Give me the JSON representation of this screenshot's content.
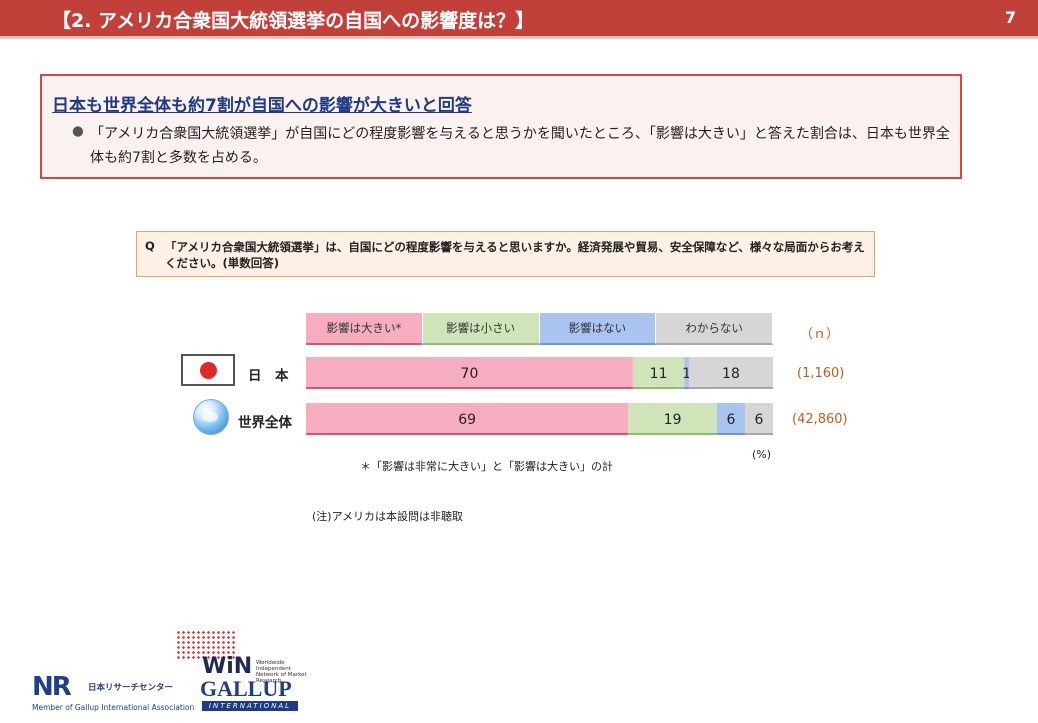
{
  "header": {
    "title": "【2. アメリカ合衆国大統領選挙の自国への影響度は？】",
    "page_number": "7"
  },
  "summary": {
    "title": "日本も世界全体も約7割が自国への影響が大きいと回答",
    "bullet": "●",
    "text": "「アメリカ合衆国大統領選挙」が自国にどの程度影響を与えると思うかを聞いたところ、「影響は大きい」と答えた割合は、日本も世界全体も約7割と多数を占める。"
  },
  "question": {
    "label": "Q",
    "text": "「アメリカ合衆国大統領選挙」は、自国にどの程度影響を与えると思いますか。経済発展や貿易、安全保障など、様々な局面からお考えください。(単数回答)"
  },
  "chart_data": {
    "type": "bar",
    "orientation": "horizontal-stacked-100",
    "unit": "(%)",
    "n_header": "（ｎ）",
    "categories": [
      "日　本",
      "世界全体"
    ],
    "n_values": [
      "(1,160)",
      "(42,860)"
    ],
    "series": [
      {
        "name": "影響は大きい*",
        "values": [
          70,
          69
        ],
        "color": "#f7adc0"
      },
      {
        "name": "影響は小さい",
        "values": [
          11,
          19
        ],
        "color": "#cfe5b9"
      },
      {
        "name": "影響はない",
        "values": [
          1,
          6
        ],
        "color": "#a9c4ef"
      },
      {
        "name": "わからない",
        "values": [
          18,
          6
        ],
        "color": "#d6d6d6"
      }
    ],
    "xlim": [
      0,
      100
    ],
    "footnote": "＊「影響は非常に大きい」と「影響は大きい」の計"
  },
  "legend_colors": {
    "border_big": "#d9546e",
    "border_small": "#8cbf6b",
    "border_none": "#6f94d6",
    "border_dk": "#a8a8a8"
  },
  "note": "(注)アメリカは本設問は非聴取",
  "logos": {
    "nrc_mark": "NR",
    "nrc_name": "日本リサーチセンター",
    "nrc_member": "Member of Gallup International Association",
    "win": "WiN",
    "win_sub": "Worldwide Independent Network of Market Research",
    "gallup": "GALLUP",
    "international": "INTERNATIONAL"
  },
  "icons": [
    "japan-flag-icon",
    "globe-icon"
  ]
}
